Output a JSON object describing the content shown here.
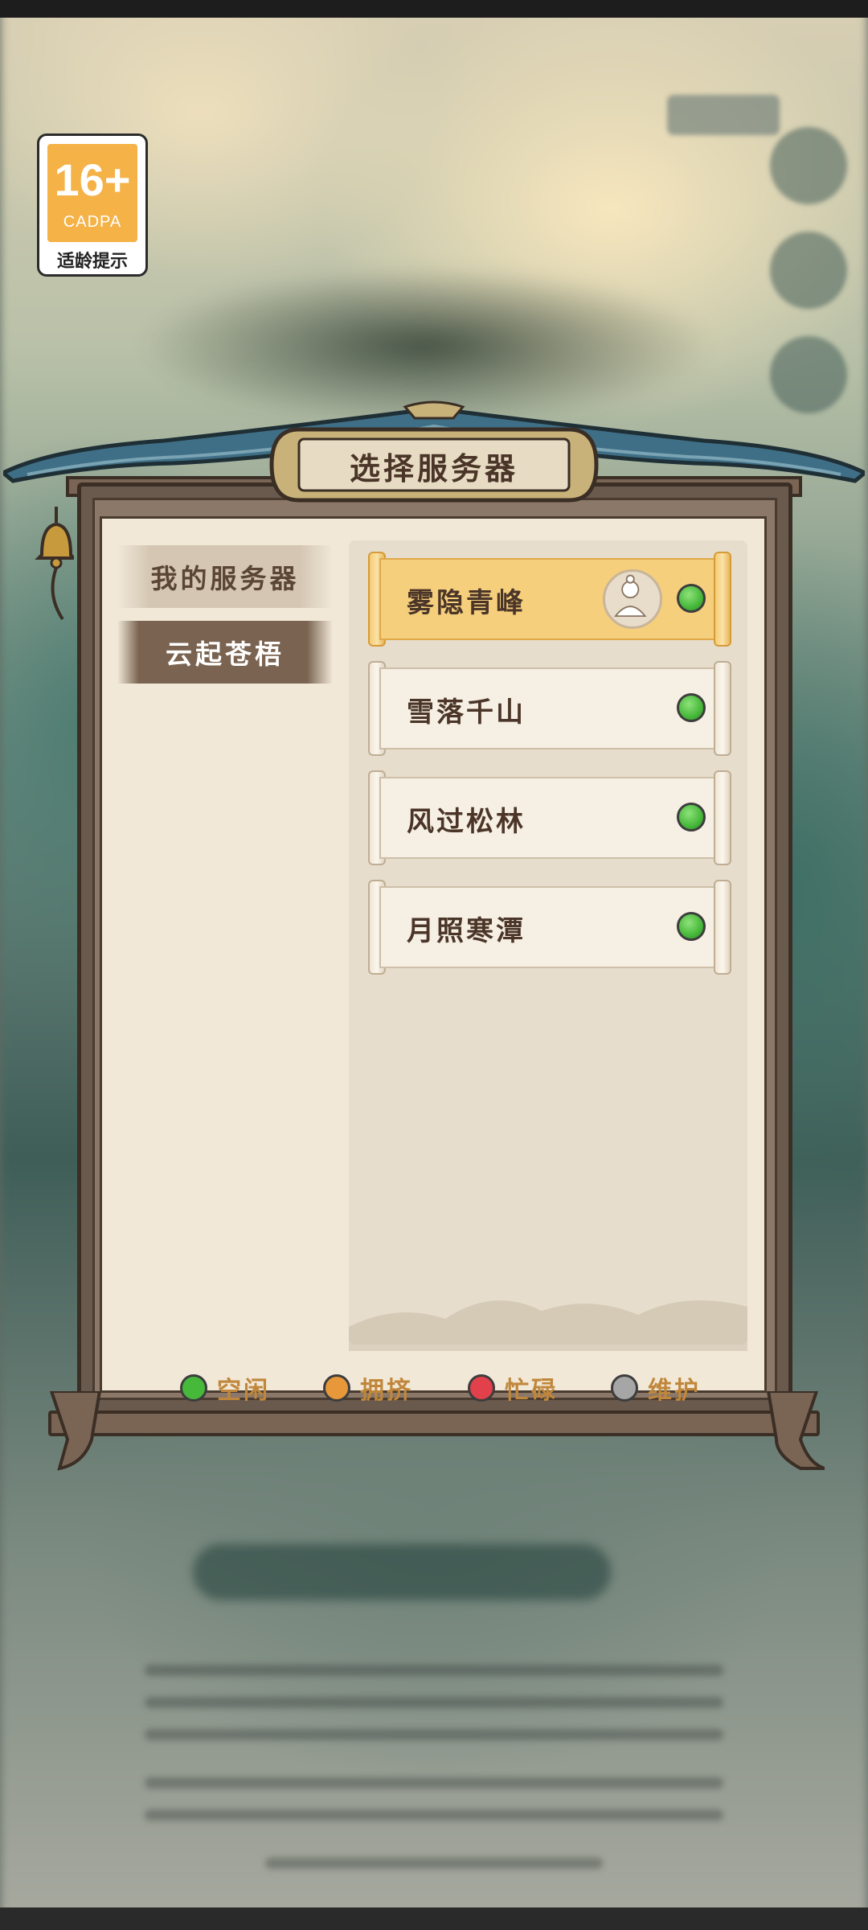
{
  "age_rating": {
    "age": "16+",
    "org": "CADPA",
    "hint": "适龄提示"
  },
  "dialog": {
    "title": "选择服务器",
    "tabs": [
      {
        "label": "我的服务器",
        "active": false
      },
      {
        "label": "云起苍梧",
        "active": true
      }
    ],
    "servers": [
      {
        "name": "雾隐青峰",
        "status": "idle",
        "selected": true,
        "has_character": true
      },
      {
        "name": "雪落千山",
        "status": "idle",
        "selected": false,
        "has_character": false
      },
      {
        "name": "风过松林",
        "status": "idle",
        "selected": false,
        "has_character": false
      },
      {
        "name": "月照寒潭",
        "status": "idle",
        "selected": false,
        "has_character": false
      }
    ],
    "legend": [
      {
        "label": "空闲",
        "status": "idle",
        "color": "#46b83a"
      },
      {
        "label": "拥挤",
        "status": "crowded",
        "color": "#e8973a"
      },
      {
        "label": "忙碌",
        "status": "busy",
        "color": "#e2404a"
      },
      {
        "label": "维护",
        "status": "maintenance",
        "color": "#a6a6a6"
      }
    ]
  },
  "colors": {
    "accent_gold": "#f5cf7c",
    "frame_brown": "#6a5a4d",
    "roof_blue": "#3f6f86",
    "paper": "#f1e8d8"
  }
}
